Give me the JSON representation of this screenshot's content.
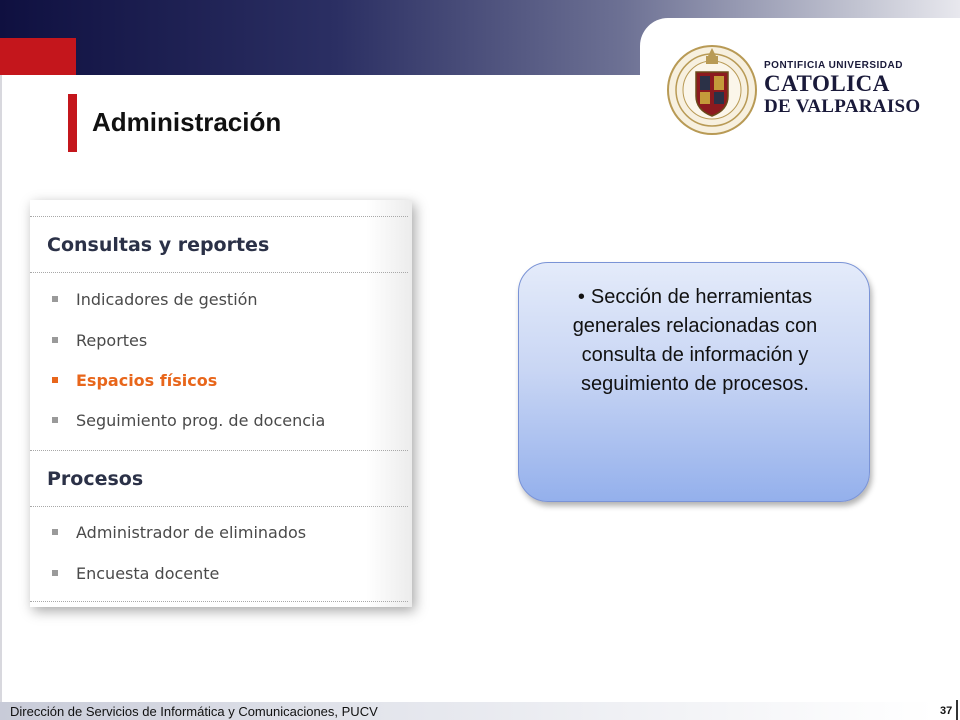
{
  "slide": {
    "title": "Administración",
    "page_number": "37",
    "footer": "Dirección de Servicios de Informática y Comunicaciones, PUCV"
  },
  "logo": {
    "line1": "PONTIFICIA UNIVERSIDAD",
    "line2": "CATOLICA",
    "line3": "DE VALPARAISO",
    "icon": "university-seal-icon"
  },
  "menu": {
    "sections": [
      {
        "heading": "Consultas y reportes",
        "items": [
          {
            "label": "Indicadores de gestión",
            "active": false
          },
          {
            "label": "Reportes",
            "active": false
          },
          {
            "label": "Espacios físicos",
            "active": true
          },
          {
            "label": "Seguimiento prog. de docencia",
            "active": false
          }
        ]
      },
      {
        "heading": "Procesos",
        "items": [
          {
            "label": "Administrador de eliminados",
            "active": false
          },
          {
            "label": "Encuesta docente",
            "active": false
          }
        ]
      }
    ]
  },
  "callout": {
    "bullet": "•",
    "text": "Sección de herramientas generales relacionadas con consulta de información y seguimiento de procesos."
  },
  "colors": {
    "accent_red": "#c4161c",
    "active_orange": "#e8661b",
    "callout_blue": "#94b0ec"
  }
}
